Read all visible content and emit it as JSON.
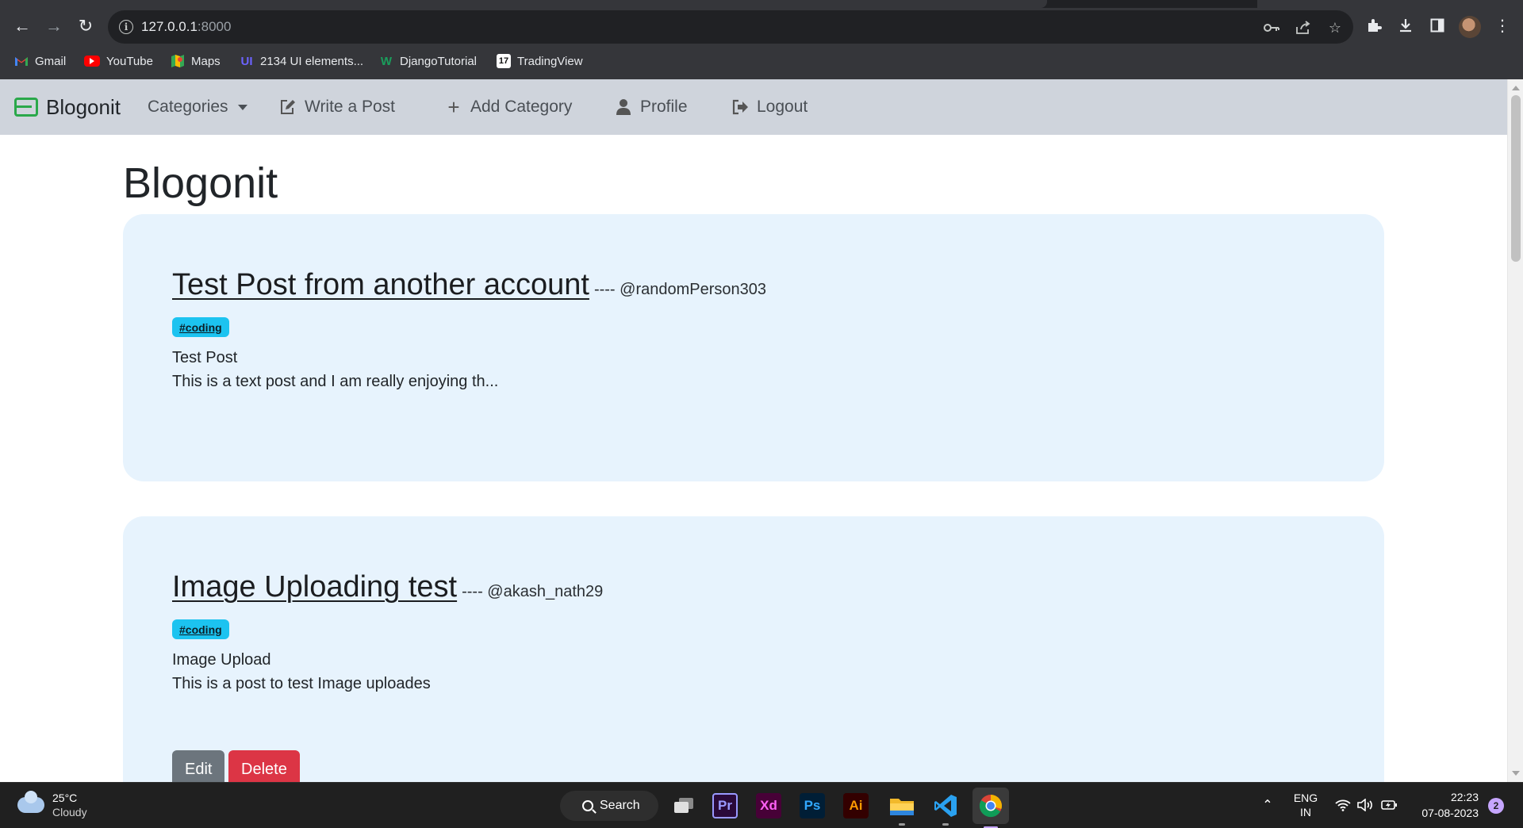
{
  "browser": {
    "url_host": "127.0.0.1",
    "url_port": ":8000",
    "bookmarks": [
      {
        "label": "Gmail",
        "icon": "gmail-icon",
        "color": "#ea4335"
      },
      {
        "label": "YouTube",
        "icon": "youtube-icon",
        "color": "#ff0000"
      },
      {
        "label": "Maps",
        "icon": "maps-icon",
        "color": "#34a853"
      },
      {
        "label": "2134 UI elements...",
        "icon": "ui-elements-icon",
        "color": "#6c5ce7"
      },
      {
        "label": "DjangoTutorial",
        "icon": "django-tutorial-icon",
        "color": "#1a9e5c"
      },
      {
        "label": "TradingView",
        "icon": "tradingview-icon",
        "color": "#ffffff"
      }
    ]
  },
  "site_nav": {
    "brand": "Blogonit",
    "categories": "Categories",
    "write_post": "Write a Post",
    "add_category": "Add Category",
    "profile": "Profile",
    "logout": "Logout"
  },
  "page": {
    "heading": "Blogonit",
    "posts": [
      {
        "title": "Test Post from another account",
        "author": "---- @randomPerson303",
        "tag": "#coding",
        "subtitle": "Test Post",
        "body": "This is a text post and I am really enjoying th..."
      },
      {
        "title": "Image Uploading test",
        "author": "---- @akash_nath29",
        "tag": "#coding",
        "subtitle": "Image Upload",
        "body": "This is a post to test Image uploades",
        "edit_label": "Edit",
        "delete_label": "Delete"
      }
    ]
  },
  "taskbar": {
    "temperature": "25°C",
    "condition": "Cloudy",
    "search_label": "Search",
    "apps": [
      {
        "name": "task-view-icon",
        "label": ""
      },
      {
        "name": "premiere-pro-icon",
        "label": "Pr",
        "color": "#9999ff",
        "bg": "#2a0a3a"
      },
      {
        "name": "adobe-xd-icon",
        "label": "Xd",
        "color": "#ff61f6",
        "bg": "#470137"
      },
      {
        "name": "photoshop-icon",
        "label": "Ps",
        "color": "#31a8ff",
        "bg": "#001e36"
      },
      {
        "name": "illustrator-icon",
        "label": "Ai",
        "color": "#ff9a00",
        "bg": "#330000"
      },
      {
        "name": "file-explorer-icon",
        "label": ""
      },
      {
        "name": "vscode-icon",
        "label": ""
      },
      {
        "name": "chrome-icon",
        "label": ""
      }
    ],
    "language": "ENG",
    "region": "IN",
    "time": "22:23",
    "date": "07-08-2023",
    "notification_count": "2"
  }
}
